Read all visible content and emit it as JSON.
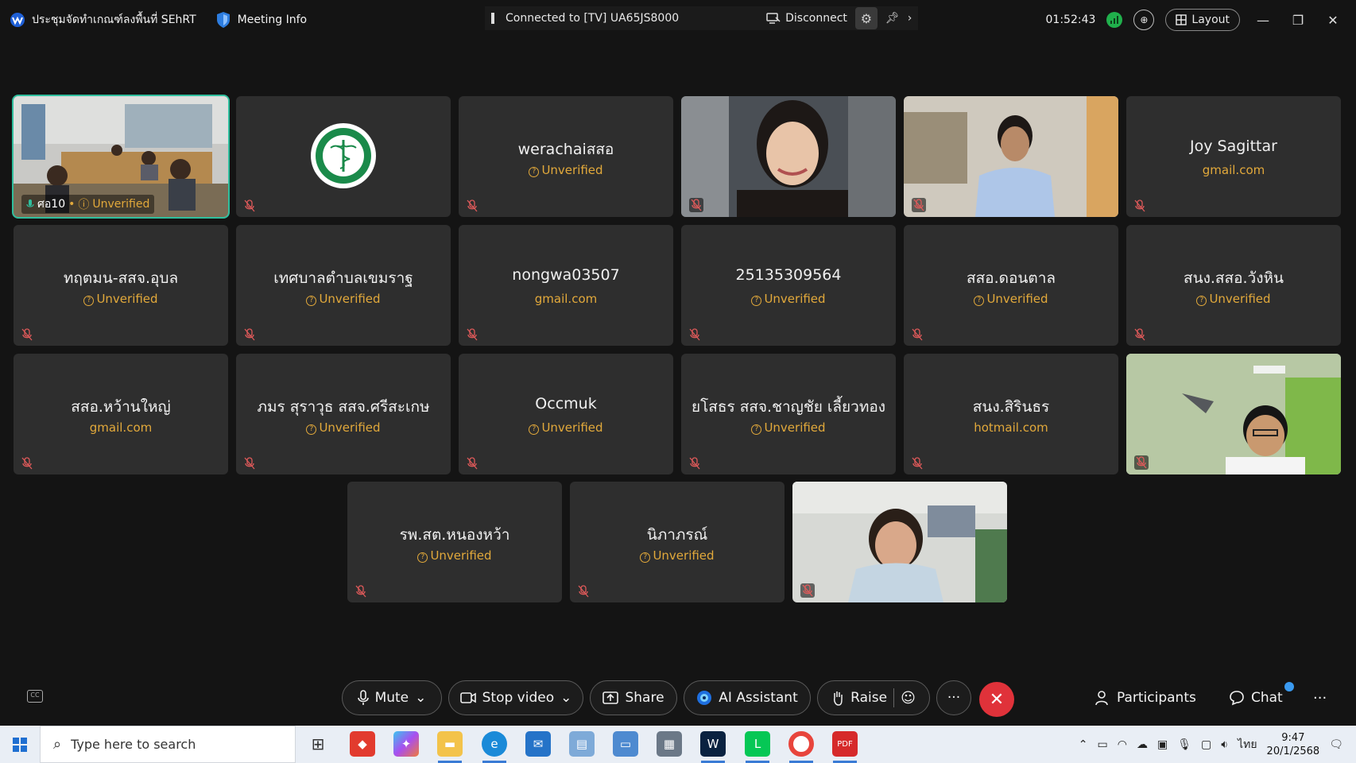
{
  "topbar": {
    "meeting_title": "ประชุมจัดทำเกณฑ์ลงพื้นที่ SEhRT",
    "meeting_info": "Meeting Info",
    "connected": "Connected to [TV] UA65JS8000",
    "disconnect": "Disconnect",
    "timer": "01:52:43",
    "layout": "Layout"
  },
  "self_tile": {
    "name": "ศอ10",
    "status": "Unverified"
  },
  "participants": [
    {
      "name": "werachaiสสอ",
      "sub": "Unverified",
      "verified": false
    },
    {
      "name": "Joy Sagittar",
      "sub": "gmail.com",
      "verified": true
    },
    {
      "name": "ทฤตมน-สสจ.อุบล",
      "sub": "Unverified",
      "verified": false
    },
    {
      "name": "เทศบาลตำบลเขมราฐ",
      "sub": "Unverified",
      "verified": false
    },
    {
      "name": "nongwa03507",
      "sub": "gmail.com",
      "verified": true
    },
    {
      "name": "25135309564",
      "sub": "Unverified",
      "verified": false
    },
    {
      "name": "สสอ.ดอนตาล",
      "sub": "Unverified",
      "verified": false
    },
    {
      "name": "สนง.สสอ.วังหิน",
      "sub": "Unverified",
      "verified": false
    },
    {
      "name": "สสอ.หว้านใหญ่",
      "sub": "gmail.com",
      "verified": true
    },
    {
      "name": "ภมร  สุราวุธ สสจ.ศรีสะเกษ",
      "sub": "Unverified",
      "verified": false
    },
    {
      "name": "Occmuk",
      "sub": "Unverified",
      "verified": false
    },
    {
      "name": "ยโสธร สสจ.ชาญชัย เลี้ยวทอง",
      "sub": "Unverified",
      "verified": false
    },
    {
      "name": "สนง.สิรินธร",
      "sub": "hotmail.com",
      "verified": true
    },
    {
      "name": "รพ.สต.หนองหว้า",
      "sub": "Unverified",
      "verified": false
    },
    {
      "name": "นิภาภรณ์",
      "sub": "Unverified",
      "verified": false
    }
  ],
  "controls": {
    "mute": "Mute",
    "stop_video": "Stop video",
    "share": "Share",
    "ai_assistant": "AI Assistant",
    "raise": "Raise",
    "participants": "Participants",
    "chat": "Chat"
  },
  "taskbar": {
    "search_placeholder": "Type here to search",
    "language": "ไทย",
    "time": "9:47",
    "date": "20/1/2568"
  },
  "colors": {
    "unverified": "#e2a93b",
    "active_border": "#2fbf9e",
    "end_call": "#e0323a",
    "signal": "#20b04c"
  }
}
